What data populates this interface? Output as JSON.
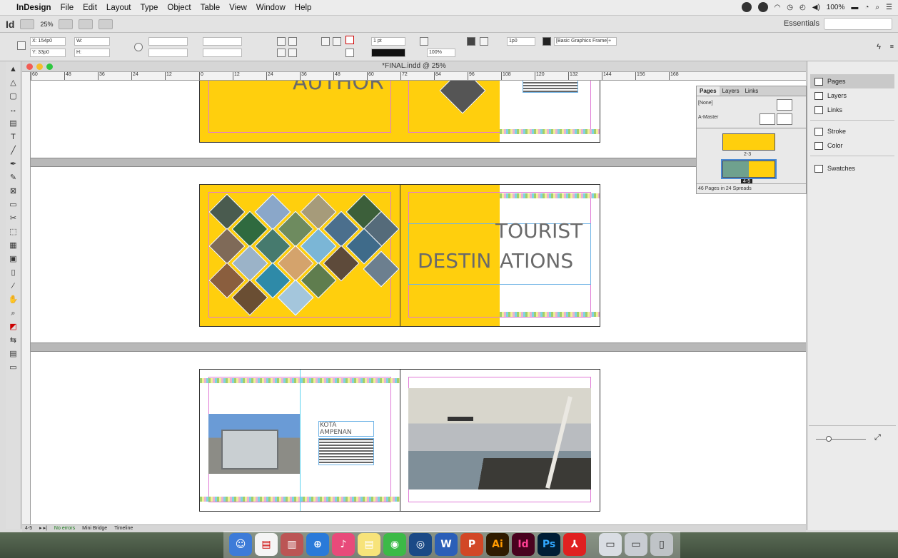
{
  "menubar": {
    "apple": "",
    "app_name": "InDesign",
    "items": [
      "File",
      "Edit",
      "Layout",
      "Type",
      "Object",
      "Table",
      "View",
      "Window",
      "Help"
    ],
    "battery": "100%"
  },
  "appbar": {
    "logo": "Id",
    "zoom": "25%",
    "workspace": "Essentials"
  },
  "control": {
    "x": "X: 154p0",
    "y": "Y: 33p0",
    "w": "W:",
    "h": "H:",
    "stroke": "1 pt",
    "percent": "100%",
    "gap": "1p0",
    "frame_style": "[Basic Graphics Frame]+"
  },
  "document": {
    "title": "*FINAL.indd @ 25%"
  },
  "ruler": {
    "ticks": [
      "60",
      "48",
      "36",
      "24",
      "12",
      "0",
      "12",
      "24",
      "36",
      "48",
      "60",
      "72",
      "84",
      "96",
      "108",
      "120",
      "132",
      "144",
      "156",
      "168"
    ]
  },
  "spreads": {
    "s1_heading": "AUTHOR",
    "s2_line1": "TOURIST",
    "s2_line2a": "DESTIN",
    "s2_line2b": "ATIONS",
    "s3_caption_1": "KOTA",
    "s3_caption_2": "AMPENAN"
  },
  "pages_panel": {
    "tabs": [
      "Pages",
      "Layers",
      "Links"
    ],
    "rows": [
      "[None]",
      "A-Master"
    ],
    "spread_label_1": "2-3",
    "spread_label_2": "4-5",
    "footer": "46 Pages in 24 Spreads"
  },
  "dock_panels": {
    "group1": [
      "Pages",
      "Layers",
      "Links"
    ],
    "group2": [
      "Stroke",
      "Color"
    ],
    "group3": [
      "Swatches"
    ]
  },
  "status": {
    "page": "4-5",
    "errors": "No errors",
    "mini": "Mini Bridge",
    "timeline": "Timeline"
  },
  "dock": {
    "apps": [
      "Ai",
      "Id",
      "Ps"
    ]
  }
}
